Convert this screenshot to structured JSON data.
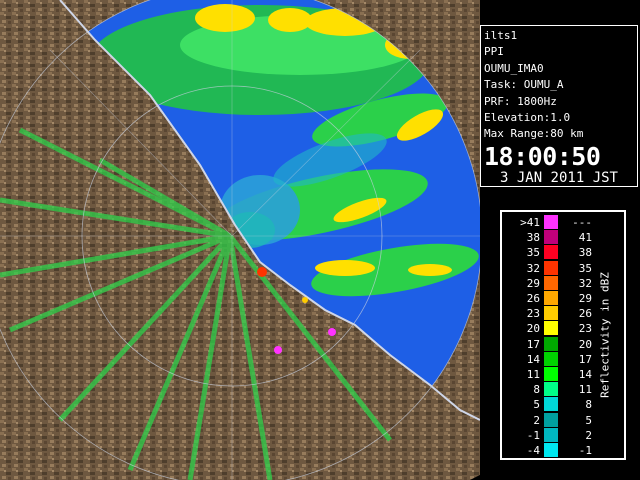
{
  "info": {
    "site": "ilts1",
    "mode": "PPI",
    "product": "OUMU_IMA0",
    "task": "Task: OUMU_A",
    "prf": "PRF: 1800Hz",
    "elevation": "Elevation:1.0",
    "max_range": "Max Range:80 km",
    "time": "18:00:50",
    "date": "3 JAN 2011 JST"
  },
  "legend": {
    "title": "Reflectivity in dBZ",
    "rows": [
      {
        "lo": ">41",
        "hi": "---",
        "color": "#ff33ff"
      },
      {
        "lo": "38",
        "hi": "41",
        "color": "#c0007a"
      },
      {
        "lo": "35",
        "hi": "38",
        "color": "#ff0022"
      },
      {
        "lo": "32",
        "hi": "35",
        "color": "#ff3300"
      },
      {
        "lo": "29",
        "hi": "32",
        "color": "#ff6600"
      },
      {
        "lo": "26",
        "hi": "29",
        "color": "#ffa800"
      },
      {
        "lo": "23",
        "hi": "26",
        "color": "#ffcc00"
      },
      {
        "lo": "20",
        "hi": "23",
        "color": "#ffff00"
      },
      {
        "lo": "17",
        "hi": "20",
        "color": "#00a800"
      },
      {
        "lo": "14",
        "hi": "17",
        "color": "#00d200"
      },
      {
        "lo": "11",
        "hi": "14",
        "color": "#00ff00"
      },
      {
        "lo": "8",
        "hi": "11",
        "color": "#00ff88"
      },
      {
        "lo": "5",
        "hi": "8",
        "color": "#00d8d8"
      },
      {
        "lo": "2",
        "hi": "5",
        "color": "#00a0a0"
      },
      {
        "lo": "-1",
        "hi": "2",
        "color": "#00b8c0"
      },
      {
        "lo": "-4",
        "hi": "-1",
        "color": "#00e8f0"
      }
    ]
  },
  "map": {
    "sea_color": "#1e5fe6",
    "land_color": "#6e5840",
    "outside_color": "#000000"
  }
}
